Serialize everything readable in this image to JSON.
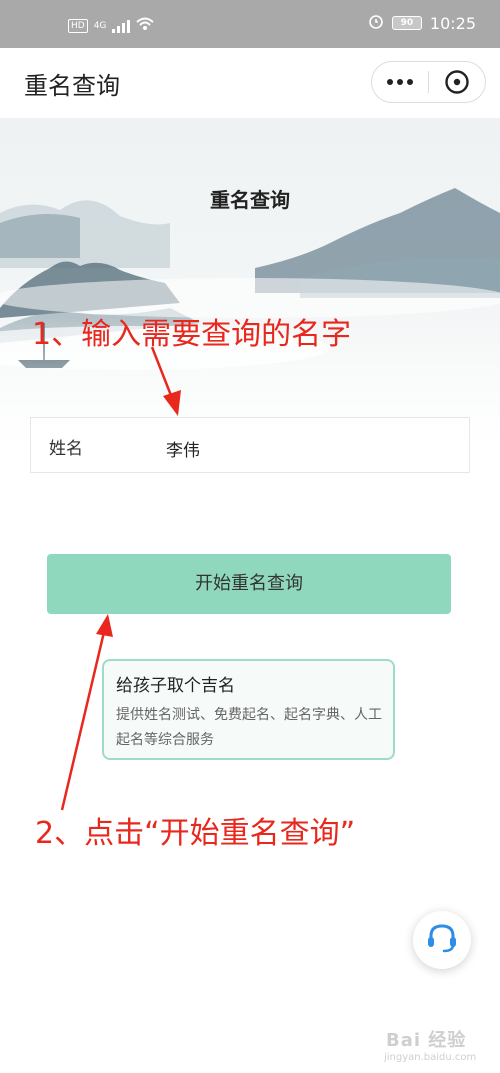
{
  "status_bar": {
    "network_badge": "HD",
    "network_type": "4G",
    "battery": "90",
    "time": "10:25",
    "icons": [
      "signal-icon",
      "wifi-icon",
      "alarm-icon",
      "battery-icon"
    ]
  },
  "nav": {
    "title": "重名查询",
    "more_icon": "more-dots-icon",
    "close_icon": "close-circle-icon"
  },
  "hero": {
    "title": "重名查询"
  },
  "form": {
    "name_label": "姓名",
    "name_value": "李伟"
  },
  "query_button": {
    "label": "开始重名查询",
    "color": "#8fd8bd"
  },
  "promo": {
    "title": "给孩子取个吉名",
    "description": "提供姓名测试、免费起名、起名字典、人工起名等综合服务"
  },
  "annotations": {
    "step1": "1、输入需要查询的名字",
    "step2": "2、点击“开始重名查询”",
    "color": "#e8271d"
  },
  "support": {
    "icon": "headset-icon"
  },
  "watermark": {
    "text": "Bai 经验",
    "url": "jingyan.baidu.com"
  }
}
